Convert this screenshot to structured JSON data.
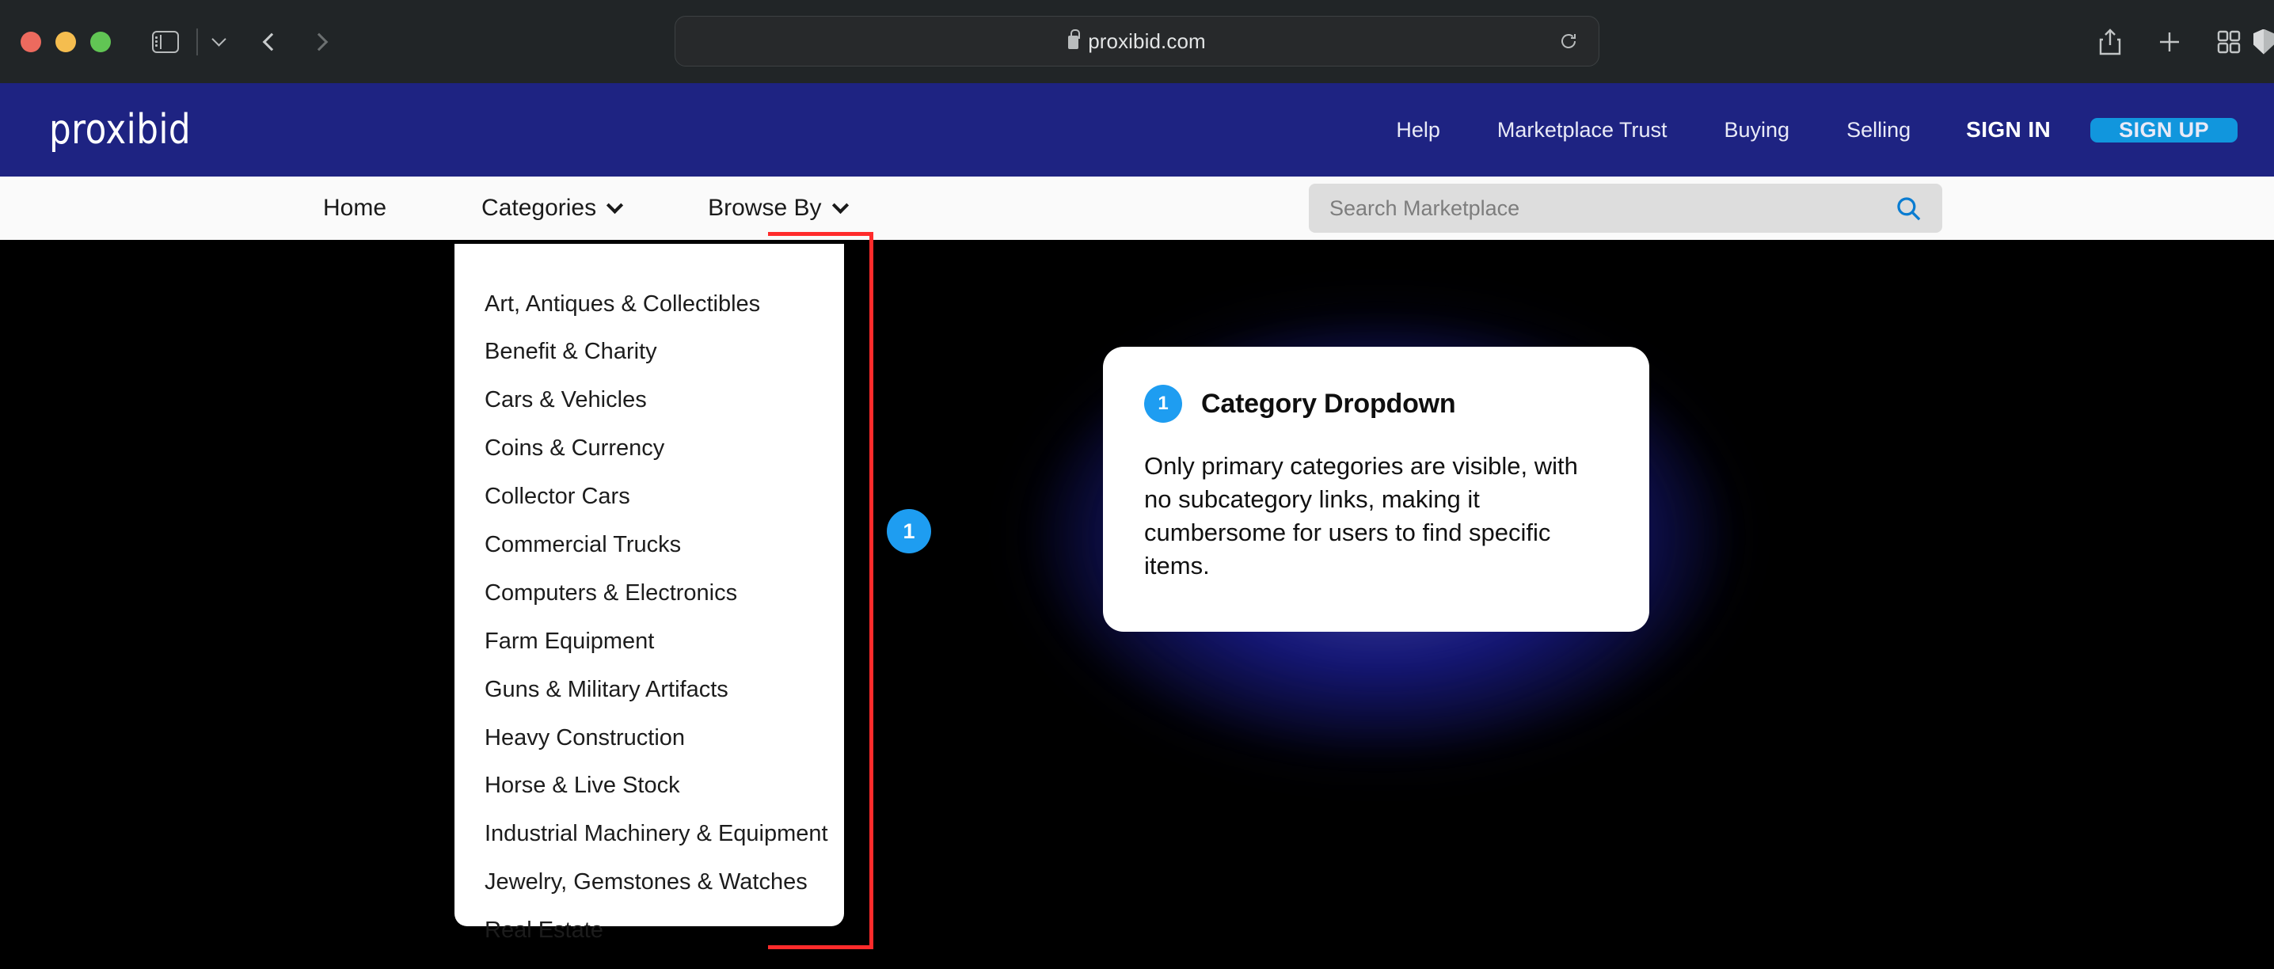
{
  "browser": {
    "traffic_lights": [
      "close",
      "minimize",
      "maximize"
    ],
    "url": "proxibid.com",
    "url_secure_icon": "lock-icon",
    "reload_icon": "reload-icon",
    "back_icon": "back-arrow-icon",
    "forward_icon": "forward-arrow-icon",
    "sidebar_icon": "sidebar-toggle-icon",
    "privacy_icon": "shield-icon",
    "share_icon": "share-icon",
    "new_tab_icon": "plus-icon",
    "tab_overview_icon": "tab-grid-icon"
  },
  "site_header": {
    "logo": "proxibid",
    "brand_color": "#1e2382",
    "accent_color": "#1196dd",
    "nav": [
      {
        "label": "Help"
      },
      {
        "label": "Marketplace Trust"
      },
      {
        "label": "Buying"
      },
      {
        "label": "Selling"
      }
    ],
    "sign_in": "SIGN IN",
    "sign_up": "SIGN UP"
  },
  "sub_nav": {
    "home": "Home",
    "categories": "Categories",
    "browse_by": "Browse By",
    "chevron_icon": "chevron-down-icon"
  },
  "search": {
    "placeholder": "Search Marketplace",
    "value": "",
    "icon": "search-icon",
    "icon_color": "#0a7cd1"
  },
  "category_dropdown": {
    "items": [
      {
        "label": "Art, Antiques & Collectibles"
      },
      {
        "label": "Benefit & Charity"
      },
      {
        "label": "Cars & Vehicles"
      },
      {
        "label": "Coins & Currency"
      },
      {
        "label": "Collector Cars"
      },
      {
        "label": "Commercial Trucks"
      },
      {
        "label": "Computers & Electronics"
      },
      {
        "label": "Farm Equipment"
      },
      {
        "label": "Guns & Military Artifacts"
      },
      {
        "label": "Heavy Construction"
      },
      {
        "label": "Horse & Live Stock"
      },
      {
        "label": "Industrial Machinery & Equipment"
      },
      {
        "label": "Jewelry, Gemstones & Watches"
      },
      {
        "label": "Real Estate"
      }
    ]
  },
  "annotation": {
    "marker_number": "1",
    "marker_color": "#1e9df1",
    "highlight_color": "#ff2b2b",
    "callout": {
      "number": "1",
      "title": "Category Dropdown",
      "body": "Only primary categories are visible, with no subcategory links, making it cumbersome for users to find specific items."
    }
  }
}
